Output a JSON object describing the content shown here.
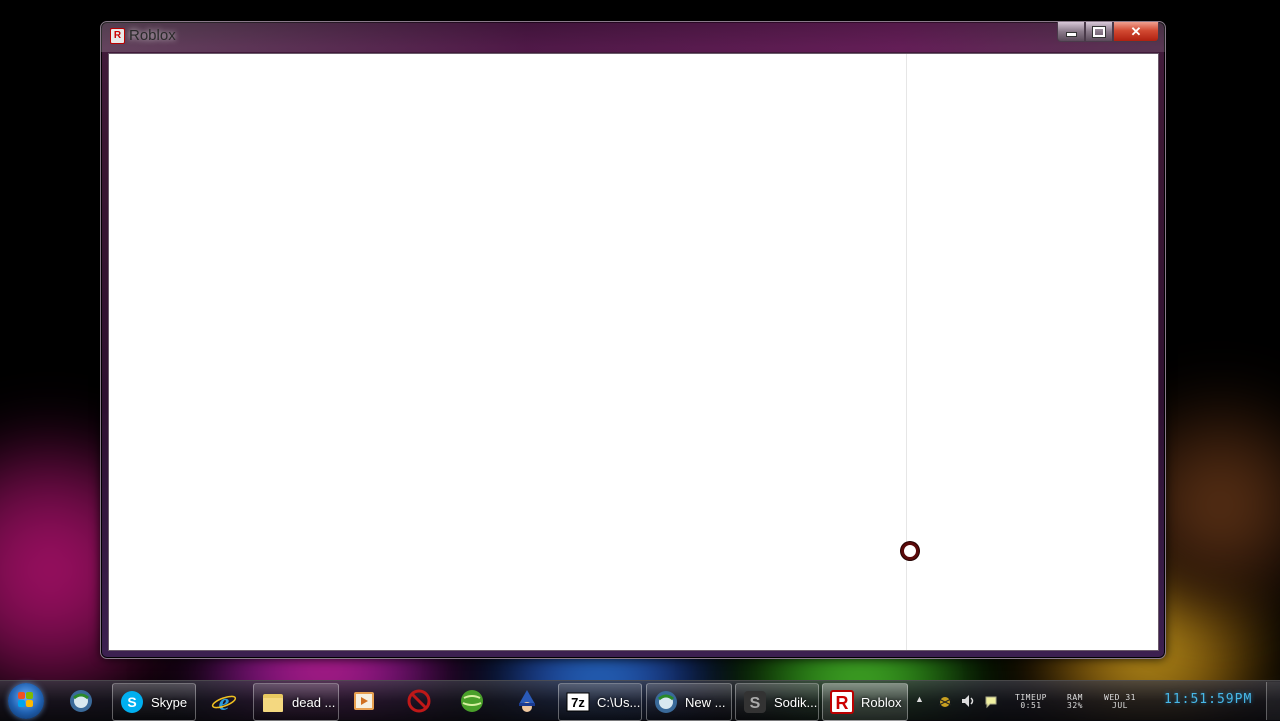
{
  "window": {
    "title": "Roblox",
    "app_icon_letter": "R",
    "close_glyph": "✕"
  },
  "taskbar": {
    "start_icon": "windows-start-orb",
    "items": [
      {
        "icon": "browser-icon",
        "label": ""
      },
      {
        "icon": "skype-icon",
        "label": "Skype"
      },
      {
        "icon": "internet-explorer-icon",
        "label": ""
      },
      {
        "icon": "folder-icon",
        "label": "dead ..."
      },
      {
        "icon": "media-player-icon",
        "label": ""
      },
      {
        "icon": "no-entry-icon",
        "label": ""
      },
      {
        "icon": "green-globe-icon",
        "label": ""
      },
      {
        "icon": "wizard-icon",
        "label": ""
      },
      {
        "icon": "7zip-icon",
        "label": "C:\\Us..."
      },
      {
        "icon": "browser-icon",
        "label": "New ..."
      },
      {
        "icon": "sodik-icon",
        "label": "Sodik..."
      },
      {
        "icon": "roblox-icon",
        "label": "Roblox"
      }
    ],
    "seven_zip_glyph": "7z",
    "sodik_glyph": "S",
    "roblox_glyph": "R"
  },
  "tray": {
    "expand_glyph": "▲",
    "timeup_label": "TIMEUP",
    "timeup_value": "0:51",
    "ram_label": "RAM",
    "ram_value": "32%",
    "date_line1": "WED 31",
    "date_line2": "JUL",
    "clock": "11:51:59PM"
  }
}
